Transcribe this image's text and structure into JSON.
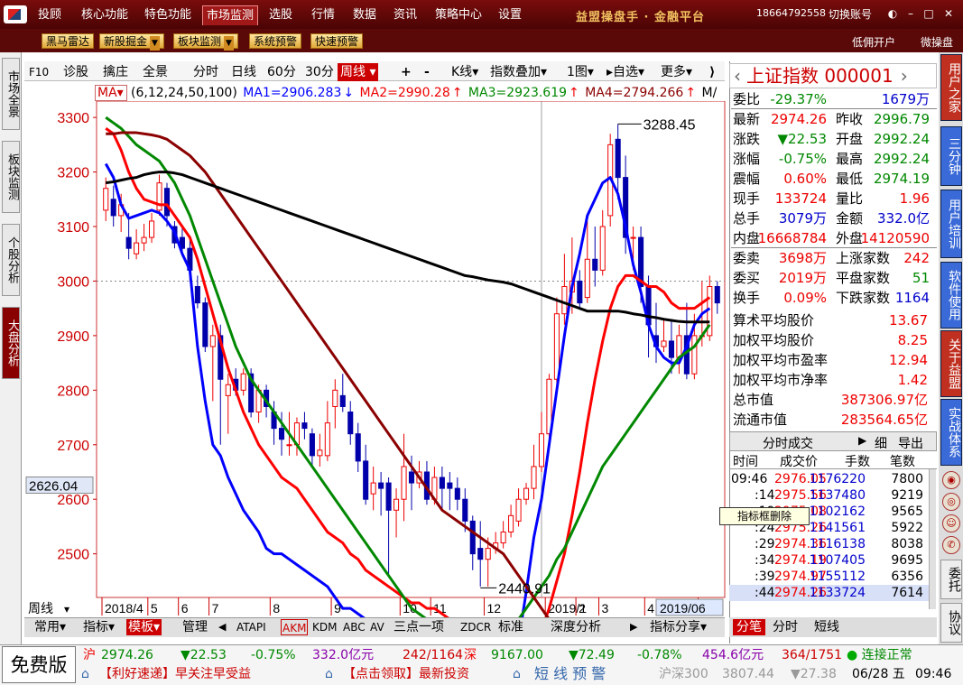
{
  "topbar": {
    "menus": [
      "投顾",
      "核心功能",
      "特色功能",
      "市场监测",
      "选股",
      "行情",
      "数据",
      "资讯",
      "策略中心",
      "设置"
    ],
    "active": "市场监测",
    "brand": "益盟操盘手 · 金融平台",
    "phone": "18664792558",
    "switch": "切换账号"
  },
  "toolbar2": {
    "buttons": [
      "黑马雷达",
      "新股掘金",
      "板块监测",
      "系统预警",
      "快速预警"
    ],
    "right": [
      "低佣开户",
      "微操盘"
    ]
  },
  "left_tabs": [
    "市场全景",
    "板块监测",
    "个股分析",
    "大盘分析"
  ],
  "chart_toolbar": {
    "items": [
      "F10",
      "诊股",
      "擒庄",
      "全景",
      "分时",
      "日线",
      "60分",
      "30分",
      "周线",
      "+",
      "-",
      "K线",
      "指数叠加",
      "1图",
      "自选",
      "更多"
    ],
    "active": "周线"
  },
  "ma_legend": {
    "label": "MA",
    "params": "(6,12,24,50,100)",
    "ma1": "MA1=2906.283",
    "ma2": "MA2=2990.28",
    "ma3": "MA3=2923.619",
    "ma4": "MA4=2794.266",
    "ma5": "M/",
    "ma1_arrow": "↓",
    "ma2_arrow": "↑",
    "ma3_arrow": "↑",
    "ma4_arrow": "↑"
  },
  "chart_labels": {
    "y_cursor": "2626.04",
    "x_period": "周线",
    "x_end": "2019/06"
  },
  "chart_data": {
    "type": "candlestick",
    "y_ticks": [
      3300,
      3200,
      3100,
      3000,
      2900,
      2800,
      2700,
      2600,
      2500
    ],
    "ylim": [
      2420,
      3330
    ],
    "x_ticks": [
      "2018/4",
      "5",
      "6",
      "7",
      "8",
      "9",
      "10",
      "11",
      "12",
      "2019/1",
      "2",
      "3",
      "4",
      "5"
    ],
    "x_tick_pos": [
      0,
      6,
      10,
      14,
      22,
      30,
      39,
      43,
      50,
      58,
      62,
      65,
      71,
      78
    ],
    "reference_line": 3000,
    "high_mark": "3288.45",
    "low_mark": "2440.91",
    "candles": [
      [
        3130,
        3170,
        3190,
        3110
      ],
      [
        3150,
        3120,
        3175,
        3100
      ],
      [
        3120,
        3140,
        3160,
        3090
      ],
      [
        3080,
        3060,
        3125,
        3040
      ],
      [
        3050,
        3070,
        3095,
        3040
      ],
      [
        3070,
        3080,
        3105,
        3055
      ],
      [
        3080,
        3110,
        3125,
        3070
      ],
      [
        3130,
        3180,
        3195,
        3120
      ],
      [
        3170,
        3120,
        3180,
        3100
      ],
      [
        3100,
        3070,
        3110,
        3060
      ],
      [
        3080,
        3060,
        3100,
        3045
      ],
      [
        3060,
        3020,
        3075,
        3000
      ],
      [
        2990,
        2960,
        3010,
        2950
      ],
      [
        2960,
        2880,
        2970,
        2870
      ],
      [
        2880,
        2900,
        2920,
        2780
      ],
      [
        2900,
        2820,
        2920,
        2700
      ],
      [
        2790,
        2810,
        2830,
        2720
      ],
      [
        2820,
        2800,
        2840,
        2790
      ],
      [
        2800,
        2830,
        2840,
        2790
      ],
      [
        2830,
        2760,
        2840,
        2750
      ],
      [
        2760,
        2800,
        2810,
        2740
      ],
      [
        2800,
        2770,
        2810,
        2750
      ],
      [
        2760,
        2730,
        2780,
        2700
      ],
      [
        2730,
        2710,
        2760,
        2680
      ],
      [
        2700,
        2700,
        2760,
        2680
      ],
      [
        2700,
        2740,
        2750,
        2680
      ],
      [
        2740,
        2730,
        2760,
        2710
      ],
      [
        2720,
        2680,
        2730,
        2660
      ],
      [
        2680,
        2690,
        2720,
        2660
      ],
      [
        2680,
        2740,
        2780,
        2670
      ],
      [
        2770,
        2800,
        2820,
        2730
      ],
      [
        2790,
        2770,
        2830,
        2760
      ],
      [
        2760,
        2720,
        2780,
        2700
      ],
      [
        2720,
        2670,
        2740,
        2650
      ],
      [
        2670,
        2600,
        2700,
        2590
      ],
      [
        2610,
        2630,
        2660,
        2580
      ],
      [
        2630,
        2620,
        2650,
        2570
      ],
      [
        2630,
        2580,
        2640,
        2460
      ],
      [
        2580,
        2600,
        2620,
        2530
      ],
      [
        2600,
        2660,
        2720,
        2560
      ],
      [
        2650,
        2630,
        2680,
        2580
      ],
      [
        2630,
        2650,
        2670,
        2620
      ],
      [
        2650,
        2600,
        2670,
        2590
      ],
      [
        2600,
        2640,
        2660,
        2590
      ],
      [
        2640,
        2620,
        2660,
        2580
      ],
      [
        2630,
        2620,
        2650,
        2580
      ],
      [
        2620,
        2600,
        2640,
        2580
      ],
      [
        2600,
        2560,
        2620,
        2540
      ],
      [
        2560,
        2500,
        2570,
        2470
      ],
      [
        2510,
        2490,
        2560,
        2440
      ],
      [
        2490,
        2510,
        2530,
        2440
      ],
      [
        2510,
        2520,
        2540,
        2500
      ],
      [
        2520,
        2540,
        2560,
        2510
      ],
      [
        2540,
        2570,
        2590,
        2530
      ],
      [
        2560,
        2600,
        2620,
        2550
      ],
      [
        2600,
        2620,
        2630,
        2590
      ],
      [
        2620,
        2660,
        2700,
        2600
      ],
      [
        2660,
        2720,
        2760,
        2650
      ],
      [
        2720,
        2820,
        2830,
        2700
      ],
      [
        2820,
        2940,
        2970,
        2800
      ],
      [
        2940,
        2990,
        3050,
        2920
      ],
      [
        2980,
        3000,
        3080,
        2940
      ],
      [
        3000,
        2960,
        3020,
        2950
      ],
      [
        2970,
        3040,
        3110,
        2960
      ],
      [
        3040,
        3020,
        3100,
        2990
      ],
      [
        3020,
        3100,
        3130,
        3010
      ],
      [
        3120,
        3250,
        3270,
        3100
      ],
      [
        3260,
        3190,
        3288,
        3150
      ],
      [
        3190,
        3080,
        3230,
        3050
      ],
      [
        3080,
        3080,
        3100,
        3020
      ],
      [
        3080,
        2990,
        3100,
        2960
      ],
      [
        2990,
        2920,
        3010,
        2860
      ],
      [
        2900,
        2880,
        2960,
        2850
      ],
      [
        2880,
        2890,
        2930,
        2870
      ],
      [
        2890,
        2860,
        2930,
        2830
      ],
      [
        2860,
        2900,
        2920,
        2830
      ],
      [
        2900,
        2830,
        2960,
        2820
      ],
      [
        2830,
        2900,
        2940,
        2820
      ],
      [
        2900,
        2900,
        3000,
        2880
      ],
      [
        2900,
        2990,
        3010,
        2890
      ],
      [
        2990,
        2960,
        3000,
        2940
      ]
    ],
    "series": [
      {
        "name": "MA1",
        "color": "#0000ff",
        "values": [
          3215,
          3190,
          3140,
          3115,
          3120,
          3125,
          3130,
          3125,
          3110,
          3090,
          3050,
          3020,
          2880,
          2780,
          2700,
          2680,
          2640,
          2610,
          2580,
          2560,
          2540,
          2510,
          2500,
          2500,
          2490,
          2480,
          2470,
          2460,
          2450,
          2440,
          2420,
          2400,
          2400,
          2390,
          2380,
          2370,
          2360,
          2350,
          2340,
          2330,
          2320,
          2330,
          2340,
          2330,
          2320,
          2320,
          2310,
          2300,
          2280,
          2250,
          2240,
          2240,
          2250,
          2280,
          2340,
          2430,
          2530,
          2600,
          2700,
          2800,
          2900,
          2990,
          3050,
          3120,
          3150,
          3180,
          3190,
          3160,
          3100,
          3030,
          2980,
          2920,
          2880,
          2860,
          2850,
          2850,
          2880,
          2920,
          2940,
          2950
        ]
      },
      {
        "name": "MA2",
        "color": "#ff0000",
        "values": [
          3280,
          3270,
          3240,
          3200,
          3170,
          3150,
          3145,
          3140,
          3140,
          3120,
          3100,
          3080,
          3040,
          2990,
          2940,
          2890,
          2840,
          2800,
          2760,
          2730,
          2700,
          2680,
          2660,
          2640,
          2630,
          2620,
          2600,
          2580,
          2560,
          2540,
          2530,
          2520,
          2500,
          2490,
          2470,
          2460,
          2450,
          2440,
          2430,
          2420,
          2410,
          2410,
          2400,
          2400,
          2390,
          2380,
          2370,
          2370,
          2360,
          2350,
          2340,
          2330,
          2330,
          2330,
          2320,
          2320,
          2330,
          2360,
          2400,
          2450,
          2500,
          2570,
          2650,
          2740,
          2820,
          2890,
          2950,
          2990,
          3010,
          3010,
          3000,
          2990,
          2990,
          2980,
          2960,
          2950,
          2950,
          2950,
          2960,
          2970
        ]
      },
      {
        "name": "MA3",
        "color": "#008800",
        "values": [
          3300,
          3290,
          3280,
          3265,
          3250,
          3240,
          3230,
          3220,
          3200,
          3180,
          3150,
          3120,
          3080,
          3040,
          3000,
          2960,
          2920,
          2880,
          2850,
          2820,
          2800,
          2780,
          2760,
          2740,
          2720,
          2700,
          2680,
          2660,
          2640,
          2620,
          2600,
          2580,
          2560,
          2540,
          2520,
          2500,
          2480,
          2460,
          2440,
          2420,
          2400,
          2390,
          2380,
          2370,
          2360,
          2350,
          2340,
          2330,
          2320,
          2320,
          2320,
          2330,
          2340,
          2360,
          2380,
          2400,
          2420,
          2440,
          2460,
          2490,
          2510,
          2540,
          2570,
          2600,
          2630,
          2660,
          2680,
          2700,
          2720,
          2740,
          2760,
          2780,
          2800,
          2820,
          2840,
          2860,
          2870,
          2880,
          2900,
          2920
        ]
      },
      {
        "name": "MA4",
        "color": "#8b0000",
        "values": [
          3270,
          3270,
          3272,
          3272,
          3272,
          3270,
          3268,
          3265,
          3260,
          3250,
          3240,
          3230,
          3215,
          3200,
          3180,
          3160,
          3140,
          3120,
          3100,
          3080,
          3060,
          3040,
          3020,
          3000,
          2980,
          2960,
          2940,
          2920,
          2900,
          2880,
          2860,
          2840,
          2820,
          2800,
          2780,
          2760,
          2740,
          2720,
          2700,
          2680,
          2660,
          2640,
          2620,
          2600,
          2580,
          2570,
          2560,
          2550,
          2540,
          2530,
          2520,
          2510,
          2500,
          2480,
          2460,
          2440,
          2420,
          2400,
          2380,
          2360,
          2340,
          2320,
          2310,
          2300,
          2300,
          2300,
          2300,
          2305,
          2310,
          2320,
          2325,
          2330,
          2335,
          2340,
          2340,
          2340,
          2340,
          2338,
          2338,
          2340
        ]
      },
      {
        "name": "MA5",
        "color": "#000000",
        "values": [
          3180,
          3182,
          3185,
          3188,
          3190,
          3195,
          3198,
          3200,
          3200,
          3198,
          3195,
          3190,
          3185,
          3180,
          3175,
          3170,
          3165,
          3160,
          3155,
          3150,
          3145,
          3140,
          3135,
          3130,
          3125,
          3120,
          3115,
          3110,
          3105,
          3100,
          3095,
          3090,
          3085,
          3080,
          3075,
          3070,
          3065,
          3060,
          3055,
          3050,
          3045,
          3040,
          3035,
          3030,
          3025,
          3020,
          3015,
          3010,
          3008,
          3005,
          3002,
          3000,
          2998,
          2995,
          2990,
          2985,
          2980,
          2975,
          2970,
          2965,
          2960,
          2955,
          2950,
          2945,
          2945,
          2945,
          2945,
          2945,
          2943,
          2940,
          2938,
          2935,
          2933,
          2930,
          2928,
          2926,
          2925,
          2925,
          2925,
          2925
        ]
      }
    ]
  },
  "quote": {
    "title": "上证指数",
    "code": "000001",
    "rows": [
      [
        "委比",
        "-29.37%",
        "",
        "1679万"
      ],
      [
        "最新",
        "2974.26",
        "昨收",
        "2996.79"
      ],
      [
        "涨跌",
        "▼22.53",
        "开盘",
        "2992.24"
      ],
      [
        "涨幅",
        "-0.75%",
        "最高",
        "2992.24"
      ],
      [
        "震幅",
        "0.60%",
        "最低",
        "2974.19"
      ],
      [
        "现手",
        "133724",
        "量比",
        "1.96"
      ],
      [
        "总手",
        "3079万",
        "金额",
        "332.0亿"
      ],
      [
        "内盘",
        "16668784",
        "外盘",
        "14120590"
      ],
      [
        "委卖",
        "3698万",
        "上涨家数",
        "242"
      ],
      [
        "委买",
        "2019万",
        "平盘家数",
        "51"
      ],
      [
        "换手",
        "0.09%",
        "下跌家数",
        "1164"
      ]
    ],
    "stats": [
      [
        "算术平均股价",
        "13.67"
      ],
      [
        "加权平均股价",
        "8.25"
      ],
      [
        "加权平均市盈率",
        "12.94"
      ],
      [
        "加权平均市净率",
        "1.42"
      ],
      [
        "总市值",
        "387306.97亿"
      ],
      [
        "流通市值",
        "283564.65亿"
      ]
    ],
    "trade_header": "分时成交",
    "trade_buttons": [
      "▶",
      "细",
      "导出"
    ],
    "trade_cols": [
      "时间",
      "成交价",
      "手数",
      "笔数"
    ],
    "trades": [
      [
        "09:46",
        "2976.05",
        "1176220",
        "7800"
      ],
      [
        ":14",
        "2975.56",
        "1137480",
        "9219"
      ],
      [
        ":19",
        "2975.08",
        "1102162",
        "9565"
      ],
      [
        ":24",
        "2975.26",
        "1141561",
        "5922"
      ],
      [
        ":29",
        "2974.36",
        "1116138",
        "8038"
      ],
      [
        ":34",
        "2974.19",
        "1107405",
        "9695"
      ],
      [
        ":39",
        "2974.97",
        "1155112",
        "6356"
      ],
      [
        ":44",
        "2974.26",
        "1133724",
        "7614"
      ]
    ],
    "tooltip": "指标框删除",
    "bottom_tabs": [
      "分笔",
      "分时",
      "短线"
    ]
  },
  "right_tabs": [
    "用户之家",
    "三分钟",
    "用户培训",
    "软件使用",
    "关于益盟",
    "实战体系"
  ],
  "right_bottom": [
    "委托",
    "协议"
  ],
  "bottom_tabs": [
    "常用",
    "指标",
    "模板",
    "管理",
    "ATAPI",
    "AKM",
    "KDM",
    "ABC",
    "AV",
    "三点一项",
    "ZDCR",
    "标准",
    "深度分析",
    "指标分享"
  ],
  "status": {
    "free": "免费版",
    "sh": {
      "name": "沪",
      "price": "2974.26",
      "chg": "▼22.53",
      "pct": "-0.75%",
      "amt": "332.0亿元",
      "updown": "242/1164"
    },
    "sz": {
      "name": "深",
      "price": "9167.00",
      "chg": "▼72.49",
      "pct": "-0.78%",
      "amt": "454.6亿元",
      "updown": "364/1751"
    },
    "conn": "连接正常",
    "news1": "【利好速递】早关注早受益",
    "news2": "【点击领取】最新投资",
    "alert": "短 线 预 警",
    "hs300": "沪深300",
    "hs300_val": "3807.44",
    "hs300_chg": "▼27.38",
    "date": "06/28 五",
    "time": "09:46"
  }
}
